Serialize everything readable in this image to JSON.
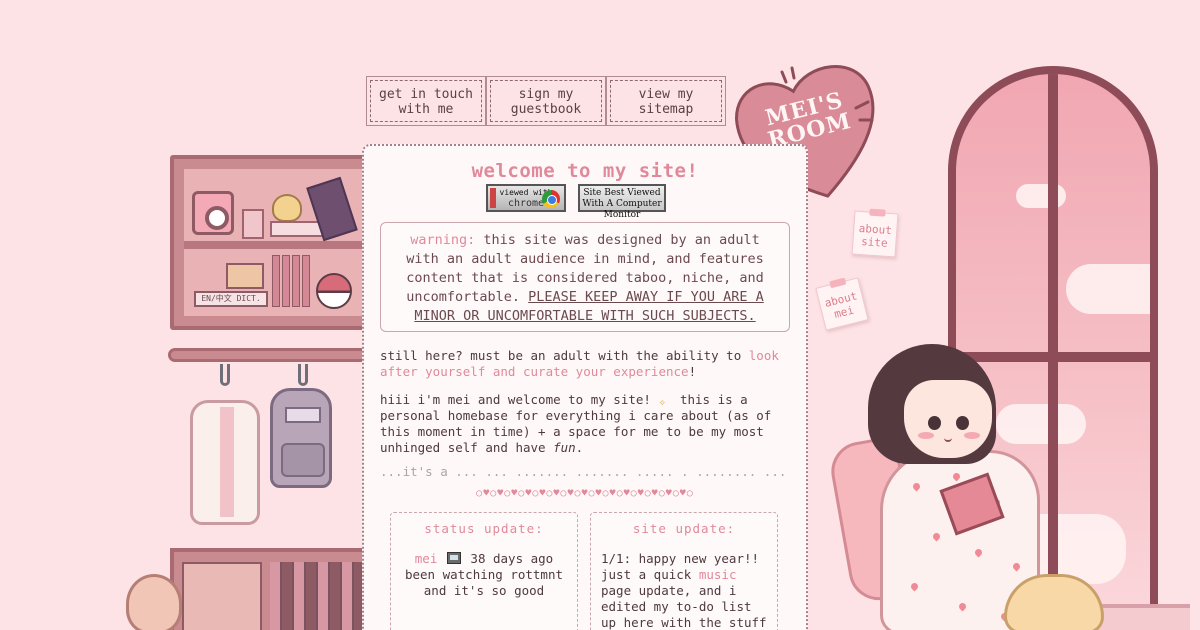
{
  "site": {
    "logo_text": "MEI'S ROOM"
  },
  "nav": [
    {
      "label": "get in touch with me"
    },
    {
      "label": "sign my guestbook"
    },
    {
      "label": "view my sitemap"
    }
  ],
  "notes": [
    {
      "label": "about site"
    },
    {
      "label": "about mei"
    }
  ],
  "main": {
    "title": "welcome to my site!",
    "badges": {
      "chrome_small": "viewed with",
      "chrome_big": "chrome",
      "monitor": "Site Best Viewed With A Computer Monitor"
    },
    "warning": {
      "lead": "warning:",
      "body": " this site was designed by an adult with an adult audience in mind, and features content that is considered taboo, niche, and uncomfortable. ",
      "caps": "PLEASE KEEP AWAY IF YOU ARE A MINOR OR UNCOMFORTABLE WITH SUCH SUBJECTS."
    },
    "intro": {
      "before": "still here? must be an adult with the ability to ",
      "link": "look after yourself and curate your experience",
      "after": "!"
    },
    "welcome": {
      "before": "hiii i'm mei and welcome to my site! ",
      "after": " this is a personal homebase for everything i care about (as of this moment in time) + a space for me to be my most unhinged self and have ",
      "emph": "fun",
      "end": "."
    },
    "faded_line": "...it's a ... ... ....... ....... ..... . ........ ..."
  },
  "divider_glyphs": "○♥○♥○♥○♥○♥○♥○♥○♥○♥○♥○♥○♥○♥○♥○♥○",
  "status_update": {
    "heading": "status update:",
    "user": "mei",
    "time": " 38 days ago",
    "text": "been watching rottmnt and it's so good"
  },
  "site_update": {
    "heading": "site update:",
    "text_before": "1/1: happy new year!! just a quick ",
    "link": "music",
    "text_after": " page update, and i edited my to-do list up here with the stuff i'm most"
  },
  "illustration": {
    "dict_label": "EN/中文 DICT."
  },
  "colors": {
    "background": "#fde3e5",
    "accent_pink": "#e0899a",
    "text": "#4e3a3e",
    "window_frame": "#8e4b58"
  }
}
